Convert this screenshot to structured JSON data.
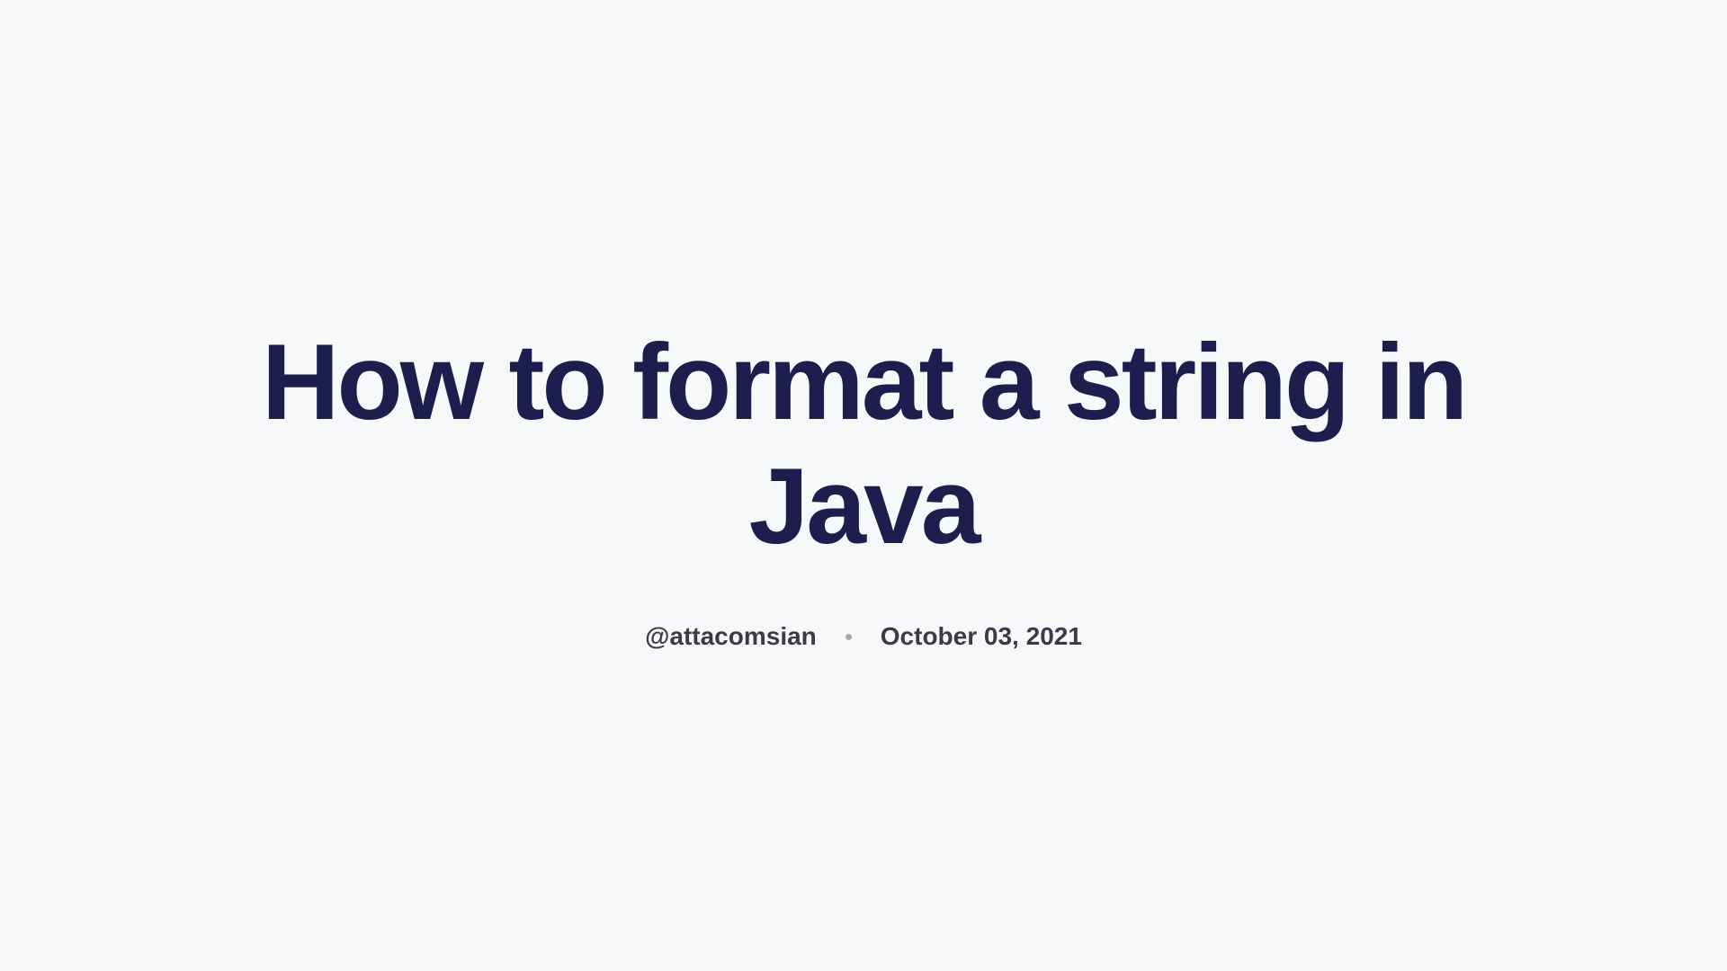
{
  "title": "How to format a string in Java",
  "author": "@attacomsian",
  "date": "October 03, 2021"
}
